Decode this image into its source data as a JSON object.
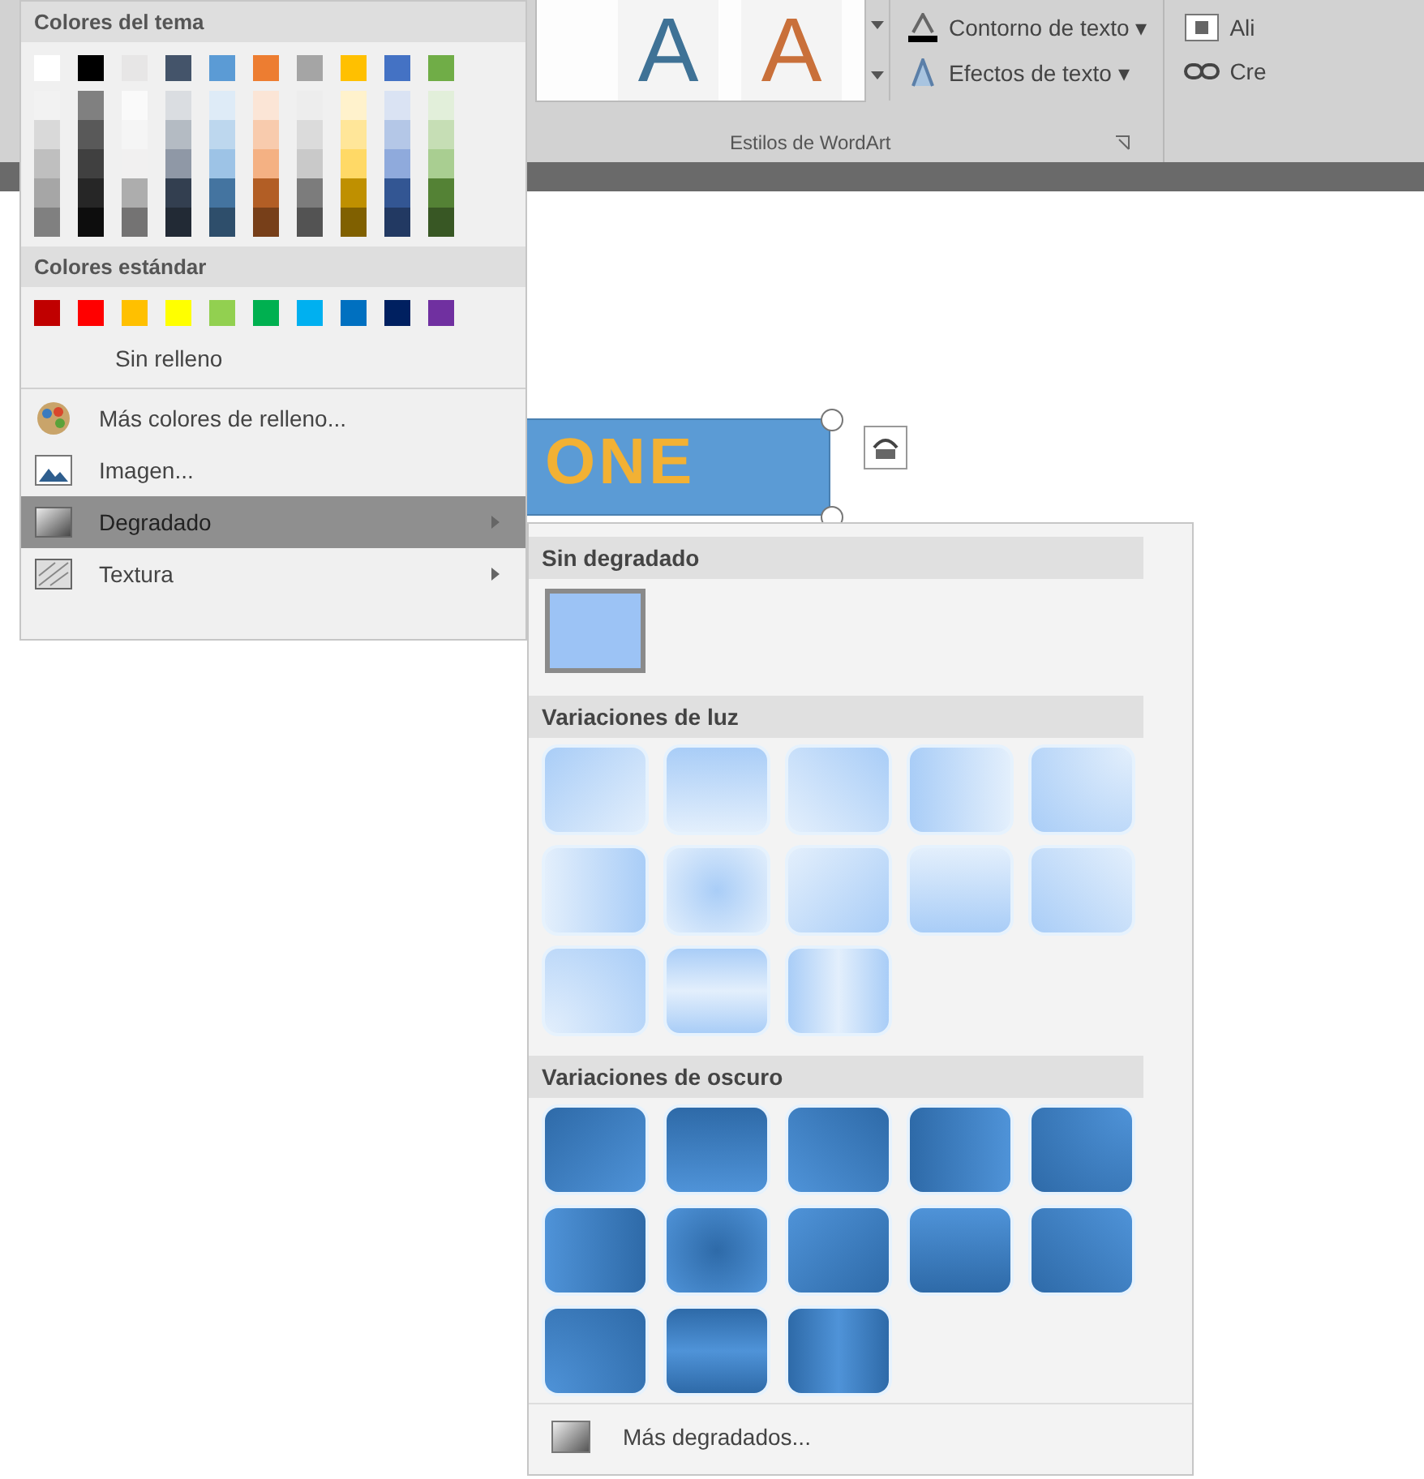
{
  "ribbon": {
    "wordart_gallery": [
      "A",
      "A"
    ],
    "commands": [
      {
        "label": "Contorno de texto",
        "caret": "▾"
      },
      {
        "label": "Efectos de texto",
        "caret": "▾"
      }
    ],
    "group_label": "Estilos de WordArt",
    "next_group": [
      "Ali",
      "Cre"
    ]
  },
  "document": {
    "shape_text": "ONE"
  },
  "fill_menu": {
    "theme_header": "Colores del tema",
    "theme_colors": [
      {
        "color": "#ffffff"
      },
      {
        "color": "#000000"
      },
      {
        "color": "#e7e6e6"
      },
      {
        "color": "#44546a"
      },
      {
        "color": "#5b9bd5"
      },
      {
        "color": "#ed7d31"
      },
      {
        "color": "#a5a5a5"
      },
      {
        "color": "#ffc000"
      },
      {
        "color": "#4472c4"
      },
      {
        "color": "#70ad47"
      }
    ],
    "standard_header": "Colores estándar",
    "standard_colors": [
      {
        "color": "#c00000"
      },
      {
        "color": "#ff0000"
      },
      {
        "color": "#ffc000"
      },
      {
        "color": "#ffff00"
      },
      {
        "color": "#92d050"
      },
      {
        "color": "#00b050"
      },
      {
        "color": "#00b0f0"
      },
      {
        "color": "#0070c0"
      },
      {
        "color": "#002060"
      },
      {
        "color": "#7030a0"
      }
    ],
    "items": [
      {
        "kind": "none",
        "label": "Sin relleno",
        "selected": false,
        "submenu": false
      },
      {
        "kind": "palette",
        "label": "Más colores de relleno...",
        "selected": false,
        "submenu": false
      },
      {
        "kind": "picture",
        "label": "Imagen...",
        "selected": false,
        "submenu": false
      },
      {
        "kind": "gradient",
        "label": "Degradado",
        "selected": true,
        "submenu": true
      },
      {
        "kind": "texture",
        "label": "Textura",
        "selected": false,
        "submenu": true
      }
    ]
  },
  "gradient_menu": {
    "sections": [
      {
        "title": "Sin degradado",
        "kind": "solid",
        "swatches": [
          {
            "kind": "solid",
            "selected": true
          }
        ]
      },
      {
        "title": "Variaciones de luz",
        "kind": "light",
        "swatches": [
          {
            "kind": "diag-tl",
            "selected": false
          },
          {
            "kind": "down",
            "selected": false
          },
          {
            "kind": "diag-tr",
            "selected": false
          },
          {
            "kind": "right",
            "selected": false
          },
          {
            "kind": "corner-tr",
            "selected": false
          },
          {
            "kind": "left",
            "selected": false
          },
          {
            "kind": "center",
            "selected": false
          },
          {
            "kind": "diag-br",
            "selected": false
          },
          {
            "kind": "up",
            "selected": false
          },
          {
            "kind": "diag-bl",
            "selected": false
          },
          {
            "kind": "corner-bl",
            "selected": false
          },
          {
            "kind": "up-mid",
            "selected": false
          },
          {
            "kind": "side-mid",
            "selected": false
          }
        ]
      },
      {
        "title": "Variaciones de oscuro",
        "kind": "dark",
        "swatches": [
          {
            "kind": "diag-tl",
            "selected": false
          },
          {
            "kind": "down",
            "selected": false
          },
          {
            "kind": "diag-tr",
            "selected": false
          },
          {
            "kind": "right",
            "selected": false
          },
          {
            "kind": "corner-tr",
            "selected": false
          },
          {
            "kind": "left",
            "selected": false
          },
          {
            "kind": "center",
            "selected": false
          },
          {
            "kind": "diag-br",
            "selected": false
          },
          {
            "kind": "up",
            "selected": false
          },
          {
            "kind": "diag-bl",
            "selected": false
          },
          {
            "kind": "corner-bl",
            "selected": false
          },
          {
            "kind": "up-mid",
            "selected": false
          },
          {
            "kind": "side-mid",
            "selected": false
          }
        ]
      }
    ],
    "footer": "Más degradados..."
  }
}
